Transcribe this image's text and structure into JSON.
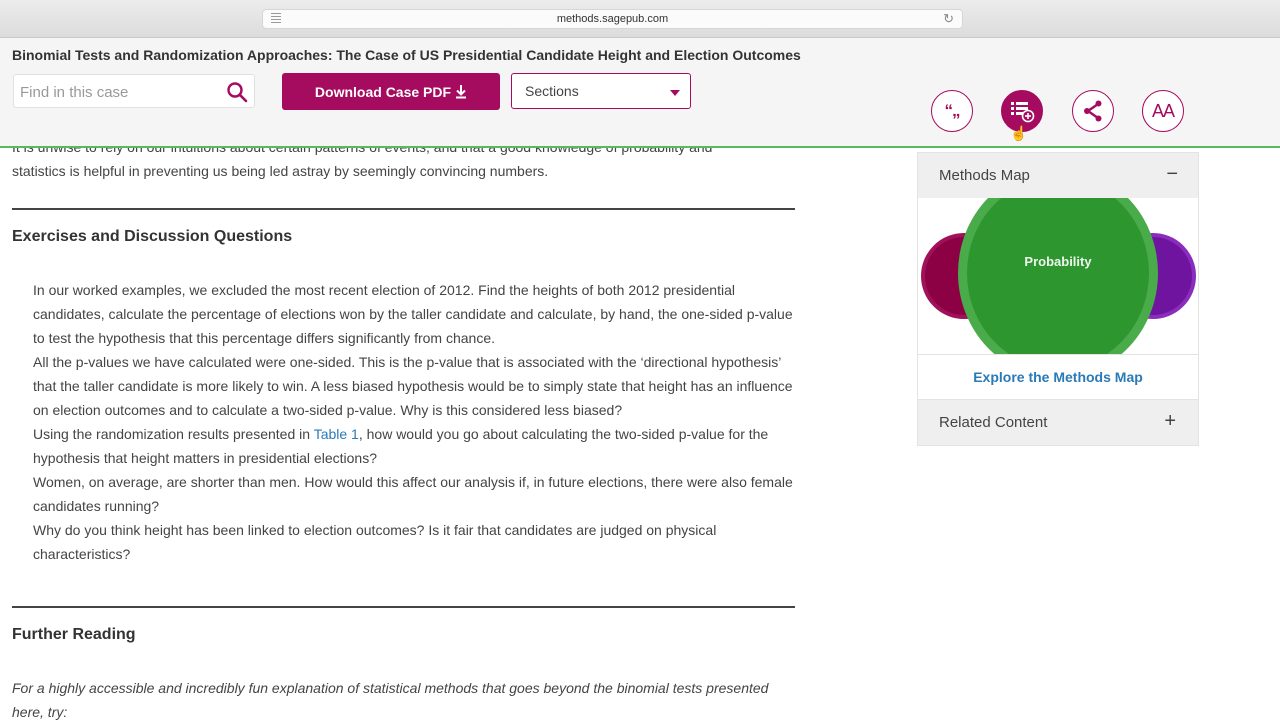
{
  "browser": {
    "url": "methods.sagepub.com",
    "reader_icon": "reader-icon",
    "reload_icon": "reload-icon"
  },
  "header": {
    "title": "Binomial Tests and Randomization Approaches: The Case of US Presidential Candidate Height and Election Outcomes",
    "search": {
      "placeholder": "Find in this case",
      "value": "",
      "icon": "search-icon"
    },
    "download_label": "Download Case PDF",
    "download_icon": "download-icon",
    "sections": {
      "selected": "Sections",
      "icon": "caret-down-icon"
    },
    "tools": [
      {
        "name": "cite",
        "icon": "quote-icon",
        "glyph": "“„"
      },
      {
        "name": "add-to-list",
        "icon": "list-add-icon",
        "active": true
      },
      {
        "name": "share",
        "icon": "share-icon"
      },
      {
        "name": "font-size",
        "icon": "font-size-icon",
        "glyph": "AA"
      }
    ],
    "accent_color": "#a50b5e",
    "divider_color": "#5cb85c"
  },
  "content": {
    "cut_text": "It is unwise to rely on our intuitions about certain patterns of events, and that a good knowledge of probability and",
    "intro_text": "statistics is helpful in preventing us being led astray by seemingly convincing numbers.",
    "exercises_heading": "Exercises and Discussion Questions",
    "questions": [
      {
        "text": "In our worked examples, we excluded the most recent election of 2012. Find the heights of both 2012 presidential candidates, calculate the percentage of elections won by the taller candidate and calculate, by hand, the one-sided p-value to test the hypothesis that this percentage differs significantly from chance."
      },
      {
        "text": "All the p-values we have calculated were one-sided. This is the p-value that is associated with the ‘directional hypothesis’ that the taller candidate is more likely to win. A less biased hypothesis would be to simply state that height has an influence on election outcomes and to calculate a two-sided p-value. Why is this considered less biased?"
      },
      {
        "before": "Using the randomization results presented in ",
        "link": "Table 1",
        "after": ", how would you go about calculating the two-sided p-value for the hypothesis that height matters in presidential elections?"
      },
      {
        "text": "Women, on average, are shorter than men. How would this affect our analysis if, in future elections, there were also female candidates running?"
      },
      {
        "text": "Why do you think height has been linked to election outcomes? Is it fair that candidates are judged on physical characteristics?"
      }
    ],
    "further_heading": "Further Reading",
    "further_text": "For a highly accessible and incredibly fun explanation of statistical methods that goes beyond the binomial tests presented here, try:",
    "link_color": "#2a7ab7"
  },
  "sidebar": {
    "methods_map": {
      "label": "Methods Map",
      "toggle": "−",
      "center_label": "Probability",
      "explore_label": "Explore the Methods Map"
    },
    "related": {
      "label": "Related Content",
      "toggle": "+"
    },
    "colors": {
      "left": "#8c0044",
      "center": "#2e962f",
      "right": "#6f149f"
    }
  }
}
